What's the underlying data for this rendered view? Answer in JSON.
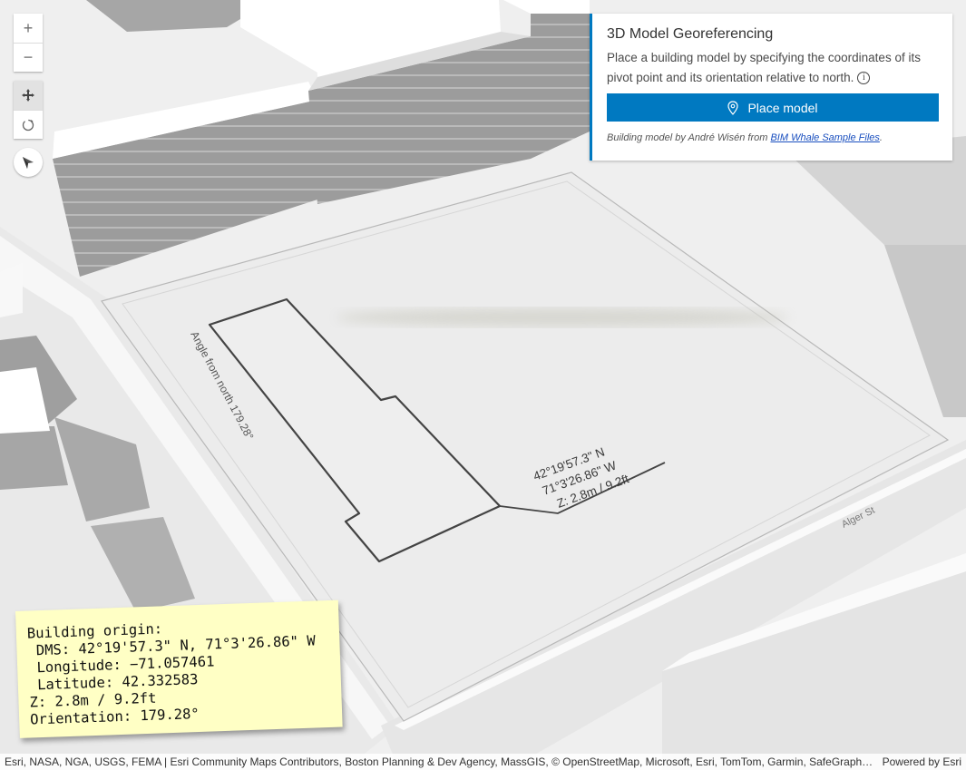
{
  "map": {
    "street_label": "Alger St",
    "angle_label": "Angle from north 179.28°",
    "coord_label_lines": [
      "42°19'57.3\" N",
      "71°3'26.86\" W",
      "Z: 2.8m / 9.2ft"
    ]
  },
  "controls": {
    "zoom_in": "+",
    "zoom_out": "−",
    "pan_mode": "pan",
    "rotate_mode": "rotate",
    "compass": "compass"
  },
  "panel": {
    "title": "3D Model Georeferencing",
    "description": "Place a building model by specifying the coordinates of its pivot point and its orientation relative to north.",
    "info_icon": "i",
    "button_label": "Place model",
    "credit_prefix": "Building model by André Wisén from ",
    "credit_link": "BIM Whale Sample Files",
    "credit_suffix": "."
  },
  "note": {
    "heading": "Building origin:",
    "dms": " DMS: 42°19'57.3\" N, 71°3'26.86\" W",
    "longitude": " Longitude: −71.057461",
    "latitude": " Latitude: 42.332583",
    "z": "Z: 2.8m / 9.2ft",
    "orientation": "Orientation: 179.28°"
  },
  "attribution": {
    "sources": "Esri, NASA, NGA, USGS, FEMA | Esri Community Maps Contributors, Boston Planning & Dev Agency, MassGIS, © OpenStreetMap, Microsoft, Esri, TomTom, Garmin, SafeGraph, GeoTechnologies, Inc, METI/NASA, USGS, EPA, NPS, US Census Bureau, USDA, USFWS",
    "powered_by": "Powered by Esri"
  },
  "colors": {
    "accent": "#0079c1",
    "note": "#ffffc5"
  }
}
